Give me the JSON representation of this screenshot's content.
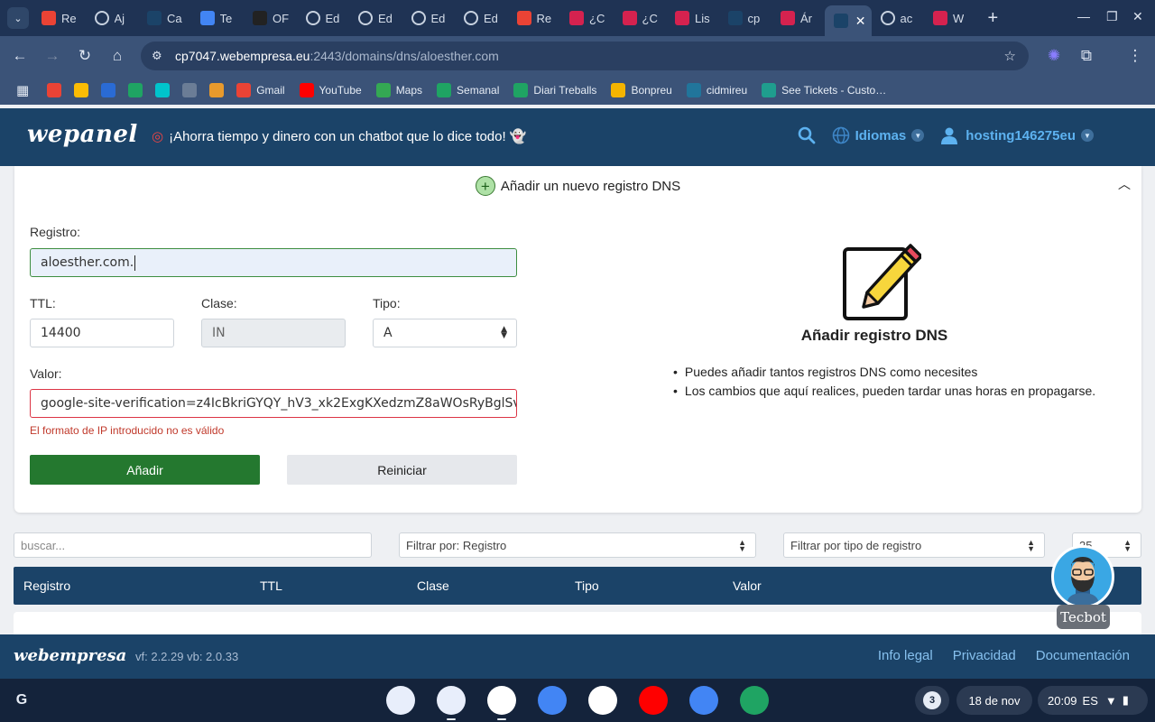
{
  "browser": {
    "tabs": [
      {
        "title": "Re",
        "icon": "gmail-icon",
        "color": "#ea4335"
      },
      {
        "title": "Aj",
        "icon": "globe-icon",
        "color": "#6b7d96"
      },
      {
        "title": "Ca",
        "icon": "wepanel-icon",
        "color": "#1b4368"
      },
      {
        "title": "Te",
        "icon": "store-icon",
        "color": "#4285f4"
      },
      {
        "title": "OF",
        "icon": "github-icon",
        "color": "#222"
      },
      {
        "title": "Ed",
        "icon": "globe-icon",
        "color": "#6b7d96"
      },
      {
        "title": "Ed",
        "icon": "globe-icon",
        "color": "#6b7d96"
      },
      {
        "title": "Ed",
        "icon": "globe-icon",
        "color": "#6b7d96"
      },
      {
        "title": "Ed",
        "icon": "globe-icon",
        "color": "#6b7d96"
      },
      {
        "title": "Re",
        "icon": "gmail-icon",
        "color": "#ea4335"
      },
      {
        "title": "¿C",
        "icon": "webempresa-icon",
        "color": "#d5224f"
      },
      {
        "title": "¿C",
        "icon": "webempresa-icon",
        "color": "#d5224f"
      },
      {
        "title": "Lis",
        "icon": "webempresa-icon",
        "color": "#d5224f"
      },
      {
        "title": "cp",
        "icon": "wepanel-icon",
        "color": "#1b4368"
      },
      {
        "title": "Ár",
        "icon": "webempresa-icon",
        "color": "#d5224f"
      }
    ],
    "active_tab": {
      "icon": "wepanel-icon"
    },
    "after_tabs": [
      {
        "title": "ac",
        "icon": "globe-icon",
        "color": "#6b7d96"
      },
      {
        "title": "W",
        "icon": "webempresa-icon",
        "color": "#d5224f"
      }
    ],
    "url_host": "cp7047.webempresa.eu",
    "url_path": ":2443/domains/dns/aloesther.com",
    "bookmarks": [
      {
        "label": "",
        "icon": "gmail-icon",
        "color": "#ea4335"
      },
      {
        "label": "",
        "icon": "photos-icon",
        "color": "#fbbc04"
      },
      {
        "label": "",
        "icon": "dsm-icon",
        "color": "#2a6bd4"
      },
      {
        "label": "",
        "icon": "drive-icon",
        "color": "#1fa463"
      },
      {
        "label": "",
        "icon": "canva-icon",
        "color": "#00c4cc"
      },
      {
        "label": "",
        "icon": "globe-icon",
        "color": "#6b7d96"
      },
      {
        "label": "",
        "icon": "settings-icon",
        "color": "#e89a2c"
      },
      {
        "label": "Gmail",
        "icon": "gmail-icon",
        "color": "#ea4335"
      },
      {
        "label": "YouTube",
        "icon": "youtube-icon",
        "color": "#ff0000"
      },
      {
        "label": "Maps",
        "icon": "maps-icon",
        "color": "#34a853"
      },
      {
        "label": "Semanal",
        "icon": "sheets-icon",
        "color": "#1fa463"
      },
      {
        "label": "Diari Treballs",
        "icon": "sheets-icon",
        "color": "#1fa463"
      },
      {
        "label": "Bonpreu",
        "icon": "bonpreu-icon",
        "color": "#f4b400"
      },
      {
        "label": "cidmireu",
        "icon": "wordpress-icon",
        "color": "#21759b"
      },
      {
        "label": "See Tickets - Custo…",
        "icon": "seetickets-icon",
        "color": "#1f9e8e"
      }
    ]
  },
  "header": {
    "logo": "wepanel",
    "promo": "¡Ahorra tiempo y dinero con un chatbot que lo dice todo! 👻",
    "language": "Idiomas",
    "user": "hosting146275eu"
  },
  "form": {
    "title": "Añadir un nuevo registro DNS",
    "registro_label": "Registro:",
    "registro_value": "aloesther.com.",
    "ttl_label": "TTL:",
    "ttl_value": "14400",
    "clase_label": "Clase:",
    "clase_value": "IN",
    "tipo_label": "Tipo:",
    "tipo_value": "A",
    "valor_label": "Valor:",
    "valor_value": "google-site-verification=z4IcBkriGYQY_hV3_xk2ExgKXedzmZ8aWOsRyBglSv",
    "error": "El formato de IP introducido no es válido",
    "add_button": "Añadir",
    "reset_button": "Reiniciar"
  },
  "info": {
    "title": "Añadir registro DNS",
    "bullets": [
      "Puedes añadir tantos registros DNS como necesites",
      "Los cambios que aquí realices, pueden tardar unas horas en propagarse."
    ]
  },
  "filters": {
    "search_placeholder": "buscar...",
    "filter_field": "Filtrar por: Registro",
    "filter_type": "Filtrar por tipo de registro",
    "page_size": "25"
  },
  "table": {
    "columns": [
      "Registro",
      "TTL",
      "Clase",
      "Tipo",
      "Valor"
    ]
  },
  "bot": {
    "label": "Tecbot"
  },
  "footer": {
    "logo": "webempresa",
    "version": "vf: 2.2.29 vb: 2.0.33",
    "links": [
      "Info legal",
      "Privacidad",
      "Documentación"
    ]
  },
  "shelf": {
    "apps": [
      {
        "icon": "gemini-icon",
        "color": "#e8eefb"
      },
      {
        "icon": "chrome-icon",
        "color": "#e8eefb"
      },
      {
        "icon": "gmail-icon",
        "color": "#ffffff"
      },
      {
        "icon": "calendar-icon",
        "color": "#4285f4"
      },
      {
        "icon": "meet-icon",
        "color": "#ffffff"
      },
      {
        "icon": "youtube-icon",
        "color": "#ff0000"
      },
      {
        "icon": "files-icon",
        "color": "#4285f4"
      },
      {
        "icon": "sheets-icon",
        "color": "#1fa463"
      }
    ],
    "notifications": "3",
    "date": "18 de nov",
    "time": "20:09",
    "locale": "ES"
  }
}
